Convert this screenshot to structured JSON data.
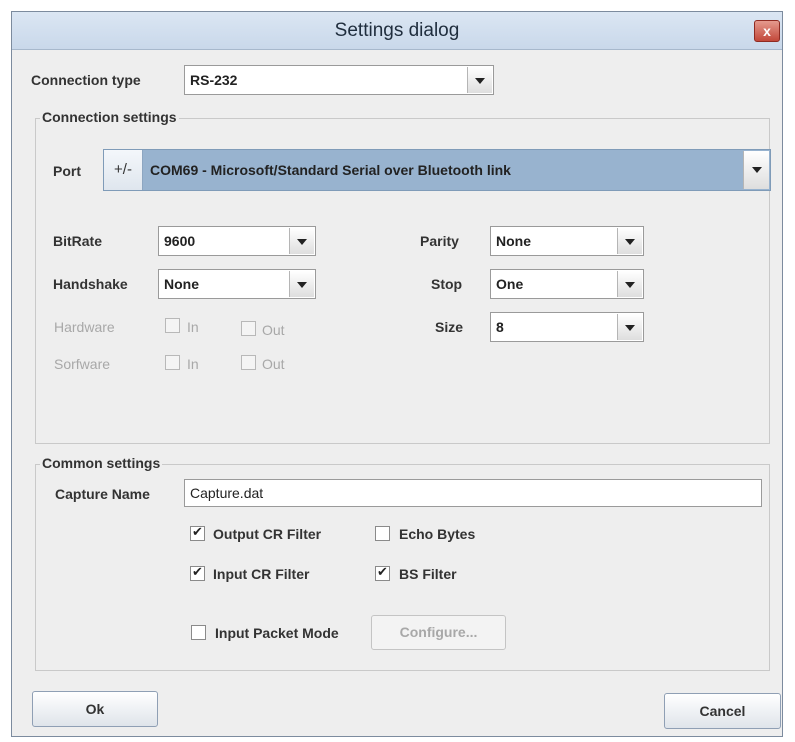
{
  "dialog": {
    "title": "Settings dialog",
    "close_glyph": "x"
  },
  "connection_type": {
    "label": "Connection type",
    "value": "RS-232"
  },
  "connection_settings": {
    "title": "Connection settings",
    "port": {
      "label": "Port",
      "toggle": "+/-",
      "value": "COM69 - Microsoft/Standard Serial over Bluetooth link"
    },
    "bitrate": {
      "label": "BitRate",
      "value": "9600"
    },
    "handshake": {
      "label": "Handshake",
      "value": "None"
    },
    "hardware": {
      "label": "Hardware",
      "in": "In",
      "out": "Out"
    },
    "software": {
      "label": "Sorfware",
      "in": "In",
      "out": "Out"
    },
    "parity": {
      "label": "Parity",
      "value": "None"
    },
    "stop": {
      "label": "Stop",
      "value": "One"
    },
    "size": {
      "label": "Size",
      "value": "8"
    }
  },
  "common_settings": {
    "title": "Common settings",
    "capture": {
      "label": "Capture Name",
      "value": "Capture.dat"
    },
    "output_cr_filter": {
      "label": "Output CR Filter",
      "checked": true
    },
    "echo_bytes": {
      "label": "Echo Bytes",
      "checked": false
    },
    "input_cr_filter": {
      "label": "Input CR Filter",
      "checked": true
    },
    "bs_filter": {
      "label": "BS Filter",
      "checked": true
    },
    "input_packet_mode": {
      "label": "Input Packet Mode",
      "checked": false
    },
    "configure_label": "Configure..."
  },
  "buttons": {
    "ok": "Ok",
    "cancel": "Cancel"
  },
  "colors": {
    "titlebar": "#c9d8ea",
    "close": "#c2483a",
    "port_highlight": "#98b3cf",
    "background": "#eeeeee"
  }
}
